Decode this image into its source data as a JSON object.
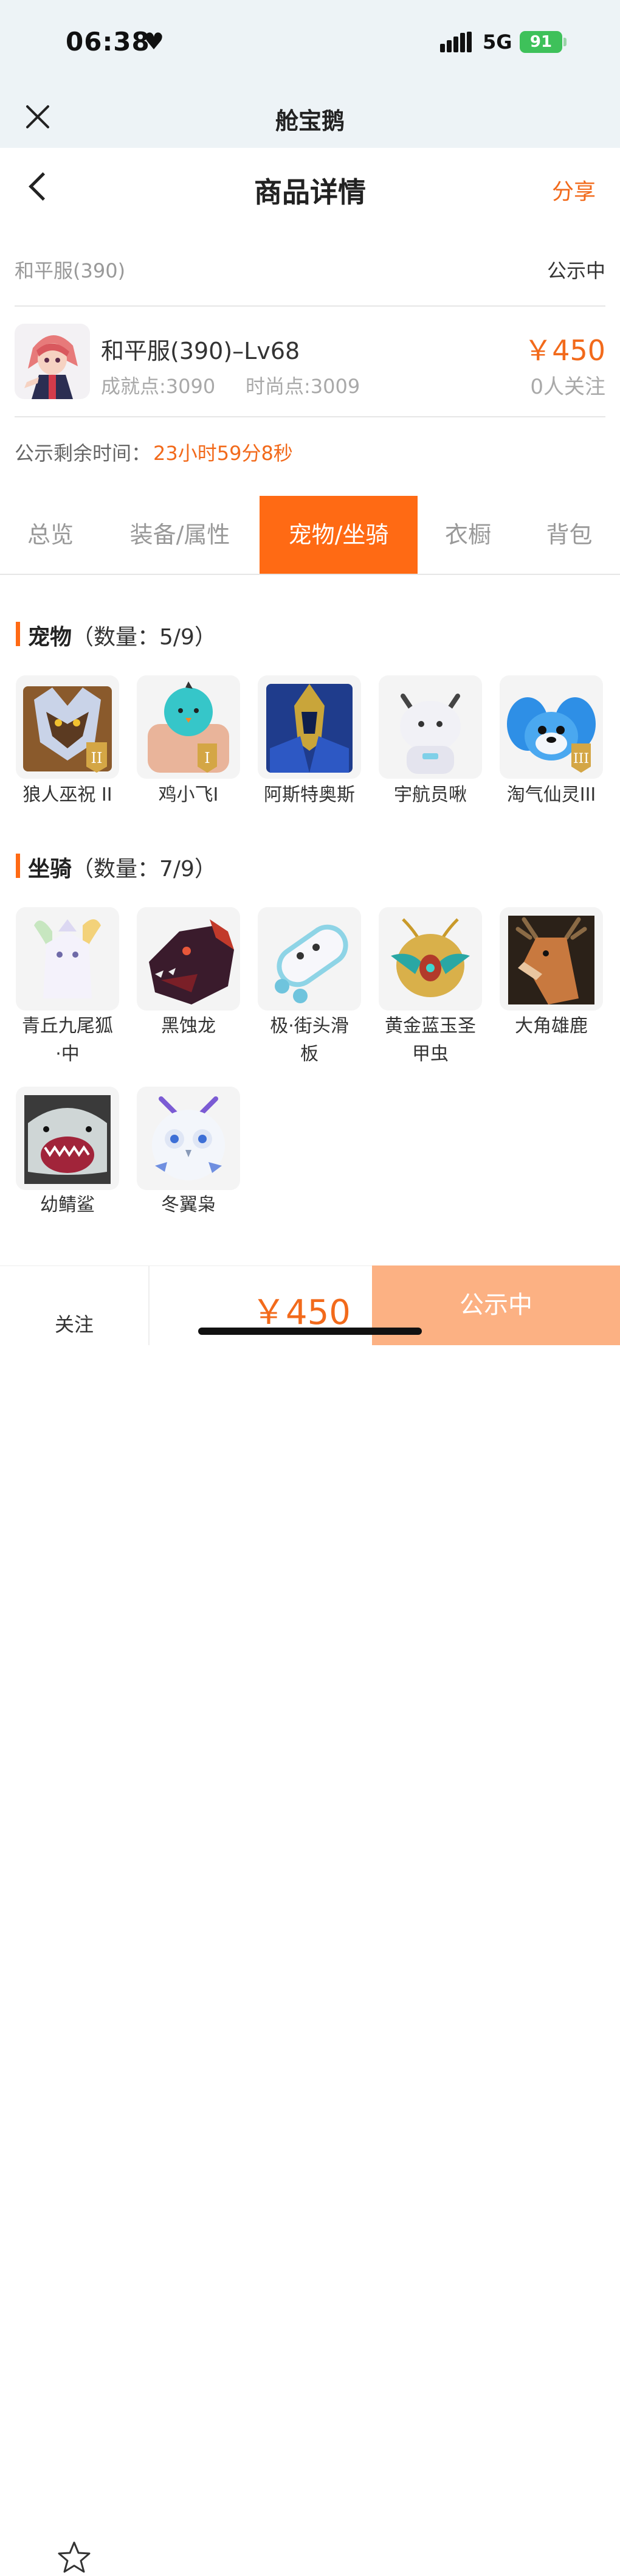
{
  "status_bar": {
    "time": "06:38",
    "network": "5G",
    "battery": "91"
  },
  "app_bar": {
    "title": "舱宝鹅"
  },
  "header": {
    "title": "商品详情",
    "share": "分享"
  },
  "product": {
    "server": "和平服(390)",
    "status": "公示中",
    "title": "和平服(390)–Lv68",
    "achievement": "成就点:3090",
    "fashion": "时尚点:3009",
    "price": "￥450",
    "followers": "0人关注",
    "timer_label": "公示剩余时间：",
    "timer_value": "23小时59分8秒"
  },
  "tabs": [
    {
      "label": "总览",
      "active": false
    },
    {
      "label": "装备/属性",
      "active": false
    },
    {
      "label": "宠物/坐骑",
      "active": true
    },
    {
      "label": "衣橱",
      "active": false
    },
    {
      "label": "背包",
      "active": false
    }
  ],
  "pets": {
    "title": "宠物",
    "count": "（数量：5/9）",
    "items": [
      {
        "name": "狼人巫祝 II",
        "badge": "II",
        "icon": "werewolf-pet-icon"
      },
      {
        "name": "鸡小飞I",
        "badge": "I",
        "icon": "chick-pet-icon"
      },
      {
        "name": "阿斯特奥斯",
        "badge": "",
        "icon": "armored-knight-pet-icon"
      },
      {
        "name": "宇航员啾",
        "badge": "",
        "icon": "astronaut-pet-icon"
      },
      {
        "name": "淘气仙灵III",
        "badge": "III",
        "icon": "blue-fairy-pet-icon"
      }
    ]
  },
  "mounts": {
    "title": "坐骑",
    "count": "（数量：7/9）",
    "items": [
      {
        "name": "青丘九尾狐·中",
        "line1": "青丘九尾狐",
        "line2": "·中",
        "icon": "nine-tail-fox-mount-icon"
      },
      {
        "name": "黑蚀龙",
        "line1": "黑蚀龙",
        "line2": "",
        "icon": "black-dragon-mount-icon"
      },
      {
        "name": "极·街头滑板",
        "line1": "极·街头滑",
        "line2": "板",
        "icon": "skateboard-mount-icon"
      },
      {
        "name": "黄金蓝玉圣甲虫",
        "line1": "黄金蓝玉圣",
        "line2": "甲虫",
        "icon": "golden-scarab-mount-icon"
      },
      {
        "name": "大角雄鹿",
        "line1": "大角雄鹿",
        "line2": "",
        "icon": "stag-mount-icon"
      },
      {
        "name": "幼鲭鲨",
        "line1": "幼鲭鲨",
        "line2": "",
        "icon": "shark-mount-icon"
      },
      {
        "name": "冬翼枭",
        "line1": "冬翼枭",
        "line2": "",
        "icon": "snow-owl-mount-icon"
      }
    ]
  },
  "bottom_bar": {
    "follow": "关注",
    "price": "￥450",
    "status": "公示中"
  },
  "colors": {
    "accent": "#ff6a14",
    "accent_light": "#fcb183",
    "price": "#f26a1b",
    "battery": "#3ec15a"
  }
}
